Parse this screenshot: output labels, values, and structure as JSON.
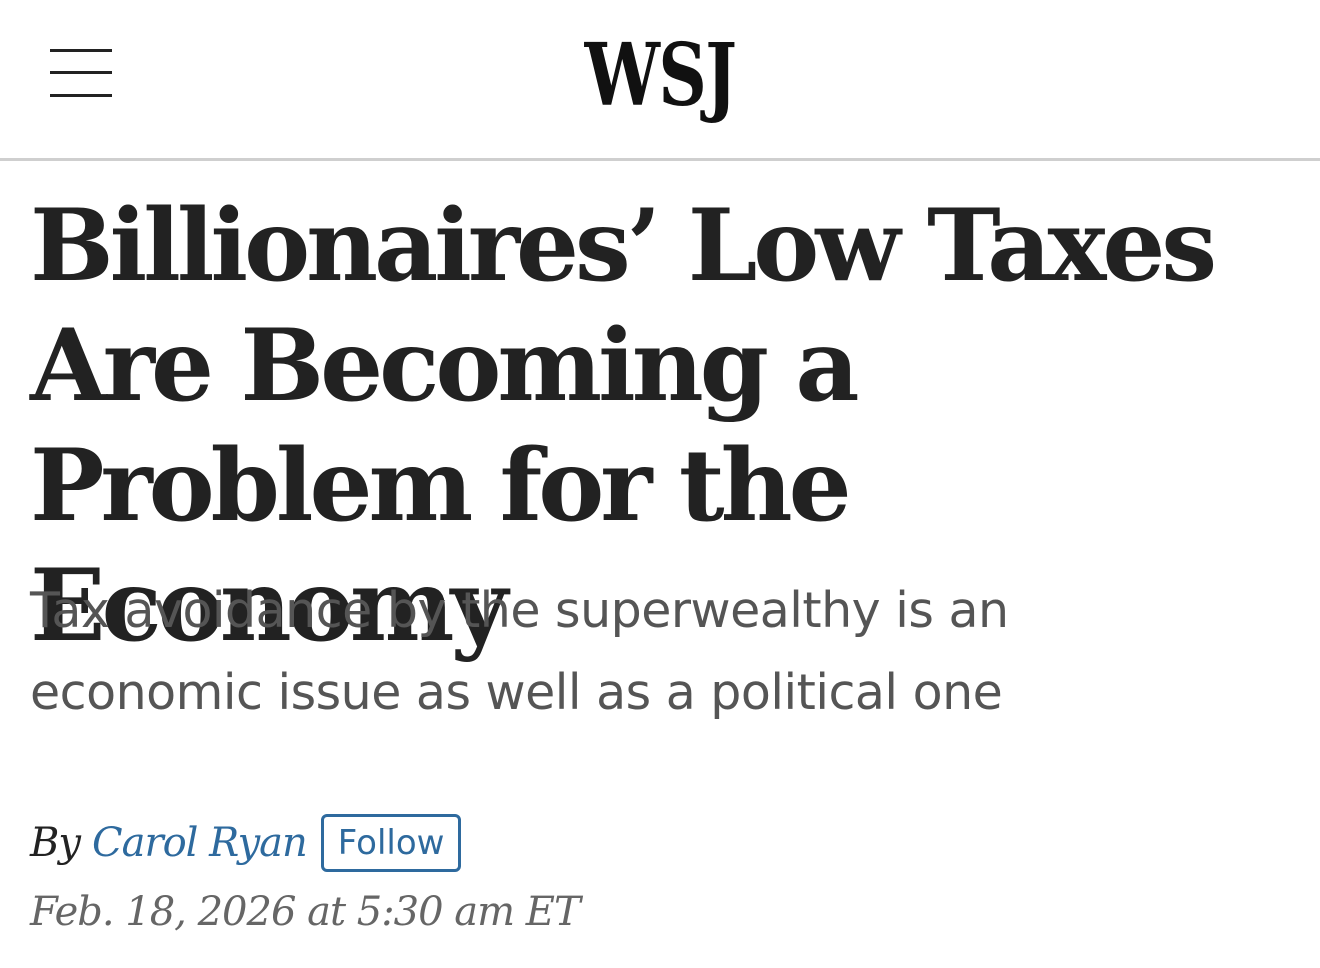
{
  "header": {
    "logo_text": "WSJ",
    "menu_icon": "hamburger-menu-icon"
  },
  "article": {
    "headline": "Billionaires’ Low Taxes Are Becoming a Problem for the Economy",
    "dek": "Tax avoidance by the superwealthy is an economic issue as well as a political one",
    "byline": {
      "prefix": "By",
      "author": "Carol Ryan",
      "follow_label": "Follow"
    },
    "timestamp": "Feb. 18, 2026 at 5:30 am ET"
  },
  "colors": {
    "link": "#2e6a9e",
    "headline": "#222222",
    "dek": "#555555",
    "timestamp": "#666666",
    "divider": "#cfcfcf"
  }
}
